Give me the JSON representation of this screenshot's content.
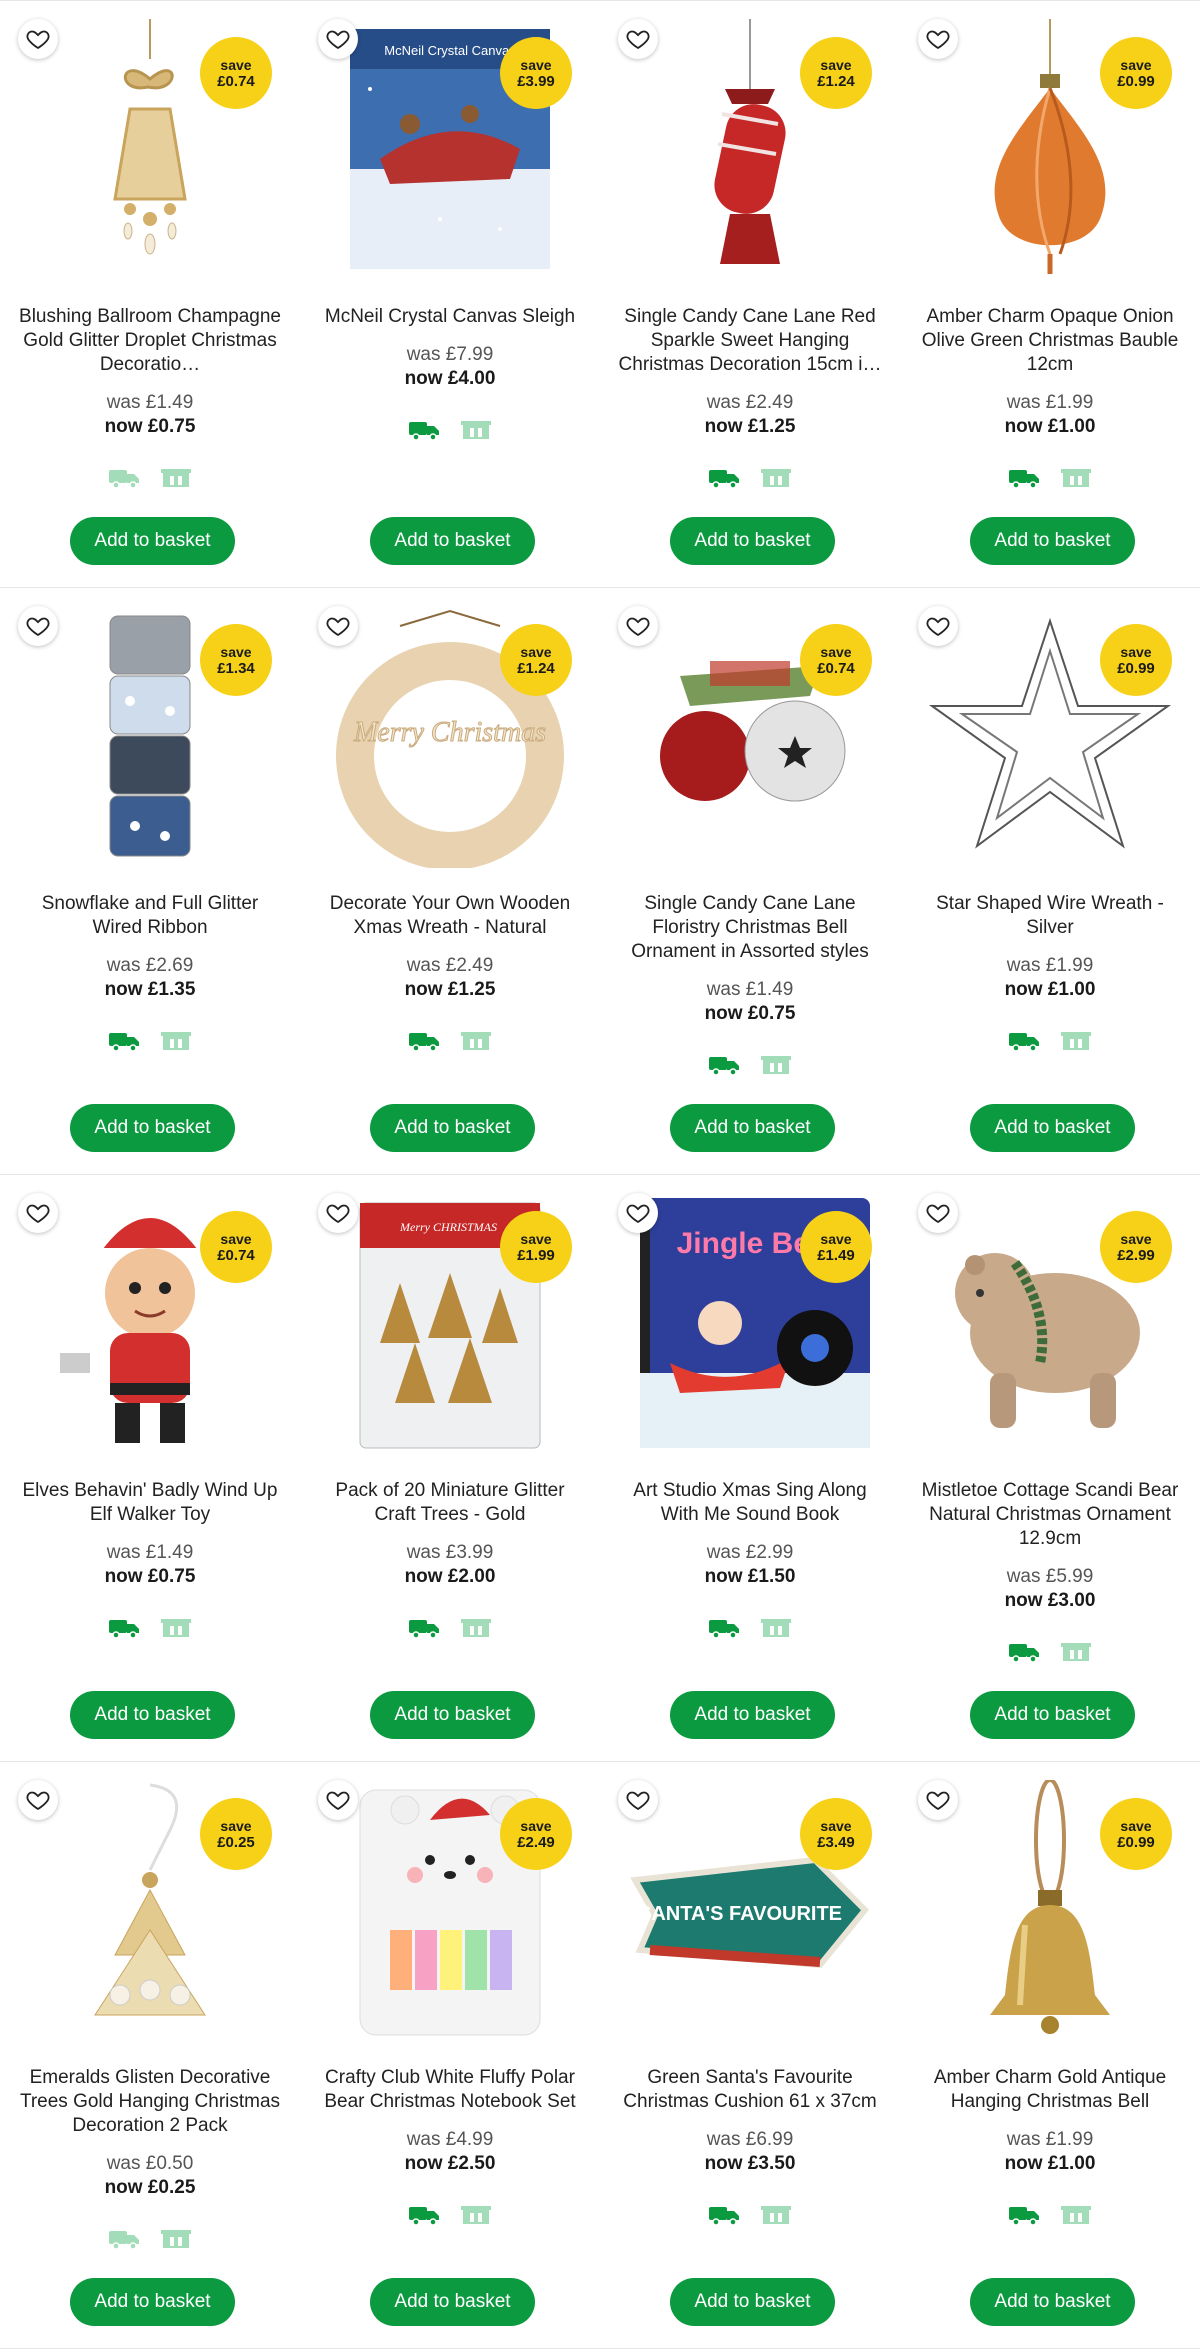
{
  "products": [
    {
      "title": "Blushing Ballroom Champagne Gold Glitter Droplet Christmas Decoratio…",
      "save_label": "save",
      "save_amount": "£0.74",
      "was": "was £1.49",
      "now": "now £0.75",
      "button": "Add to basket",
      "delivery_available": false,
      "image_icon": "gold-bow-droplet-ornament"
    },
    {
      "title": "McNeil Crystal Canvas Sleigh",
      "save_label": "save",
      "save_amount": "£3.99",
      "was": "was £7.99",
      "now": "now £4.00",
      "button": "Add to basket",
      "delivery_available": true,
      "image_icon": "crystal-canvas-kit",
      "image_text": "McNeil Crystal Canvas"
    },
    {
      "title": "Single Candy Cane Lane Red Sparkle Sweet Hanging Christmas Decoration 15cm i…",
      "save_label": "save",
      "save_amount": "£1.24",
      "was": "was £2.49",
      "now": "now £1.25",
      "button": "Add to basket",
      "delivery_available": true,
      "image_icon": "red-sweet-ornament"
    },
    {
      "title": "Amber Charm Opaque Onion Olive Green Christmas Bauble 12cm",
      "save_label": "save",
      "save_amount": "£0.99",
      "was": "was £1.99",
      "now": "now £1.00",
      "button": "Add to basket",
      "delivery_available": true,
      "image_icon": "amber-onion-bauble"
    },
    {
      "title": "Snowflake and Full Glitter Wired Ribbon",
      "save_label": "save",
      "save_amount": "£1.34",
      "was": "was £2.69",
      "now": "now £1.35",
      "button": "Add to basket",
      "delivery_available": true,
      "image_icon": "ribbon-rolls"
    },
    {
      "title": "Decorate Your Own Wooden Xmas Wreath - Natural",
      "save_label": "save",
      "save_amount": "£1.24",
      "was": "was £2.49",
      "now": "now £1.25",
      "button": "Add to basket",
      "delivery_available": true,
      "image_icon": "wooden-wreath",
      "image_text": "Merry Christmas"
    },
    {
      "title": "Single Candy Cane Lane Floristry Christmas Bell Ornament in Assorted styles",
      "save_label": "save",
      "save_amount": "£0.74",
      "was": "was £1.49",
      "now": "now £0.75",
      "button": "Add to basket",
      "delivery_available": true,
      "image_icon": "jingle-bell-ornaments"
    },
    {
      "title": "Star Shaped Wire Wreath - Silver",
      "save_label": "save",
      "save_amount": "£0.99",
      "was": "was £1.99",
      "now": "now £1.00",
      "button": "Add to basket",
      "delivery_available": true,
      "image_icon": "wire-star-wreath"
    },
    {
      "title": "Elves Behavin' Badly Wind Up Elf Walker Toy",
      "save_label": "save",
      "save_amount": "£0.74",
      "was": "was £1.49",
      "now": "now £0.75",
      "button": "Add to basket",
      "delivery_available": true,
      "image_icon": "elf-wind-up-toy"
    },
    {
      "title": "Pack of 20 Miniature Glitter Craft Trees - Gold",
      "save_label": "save",
      "save_amount": "£1.99",
      "was": "was £3.99",
      "now": "now £2.00",
      "button": "Add to basket",
      "delivery_available": true,
      "image_icon": "glitter-trees-pack",
      "image_text": "Merry CHRISTMAS"
    },
    {
      "title": "Art Studio Xmas Sing Along With Me Sound Book",
      "save_label": "save",
      "save_amount": "£1.49",
      "was": "was £2.99",
      "now": "now £1.50",
      "button": "Add to basket",
      "delivery_available": true,
      "image_icon": "jingle-bells-book",
      "image_text": "Jingle Bells"
    },
    {
      "title": "Mistletoe Cottage Scandi Bear Natural Christmas Ornament 12.9cm",
      "save_label": "save",
      "save_amount": "£2.99",
      "was": "was £5.99",
      "now": "now £3.00",
      "button": "Add to basket",
      "delivery_available": true,
      "image_icon": "scandi-bear-ornament"
    },
    {
      "title": "Emeralds Glisten Decorative Trees Gold Hanging Christmas Decoration 2 Pack",
      "save_label": "save",
      "save_amount": "£0.25",
      "was": "was £0.50",
      "now": "now £0.25",
      "button": "Add to basket",
      "delivery_available": false,
      "image_icon": "gold-tree-hanging-decoration"
    },
    {
      "title": "Crafty Club White Fluffy Polar Bear Christmas Notebook Set",
      "save_label": "save",
      "save_amount": "£2.49",
      "was": "was £4.99",
      "now": "now £2.50",
      "button": "Add to basket",
      "delivery_available": true,
      "image_icon": "polar-bear-notebook"
    },
    {
      "title": "Green Santa's Favourite Christmas Cushion 61 x 37cm",
      "save_label": "save",
      "save_amount": "£3.49",
      "was": "was £6.99",
      "now": "now £3.50",
      "button": "Add to basket",
      "delivery_available": true,
      "image_icon": "arrow-cushion",
      "image_text": "SANTA'S FAVOURITE"
    },
    {
      "title": "Amber Charm Gold Antique Hanging Christmas Bell",
      "save_label": "save",
      "save_amount": "£0.99",
      "was": "was £1.99",
      "now": "now £1.00",
      "button": "Add to basket",
      "delivery_available": true,
      "image_icon": "gold-bell"
    }
  ],
  "colors": {
    "button": "#0b9a40",
    "save_badge": "#f7d117",
    "delivery_active": "#0b9a40",
    "delivery_inactive": "#a3dcb8",
    "collect": "#a3dcb8"
  },
  "icons": {
    "favourite": "heart-outline-icon",
    "delivery": "delivery-truck-icon",
    "collect": "click-and-collect-icon"
  }
}
